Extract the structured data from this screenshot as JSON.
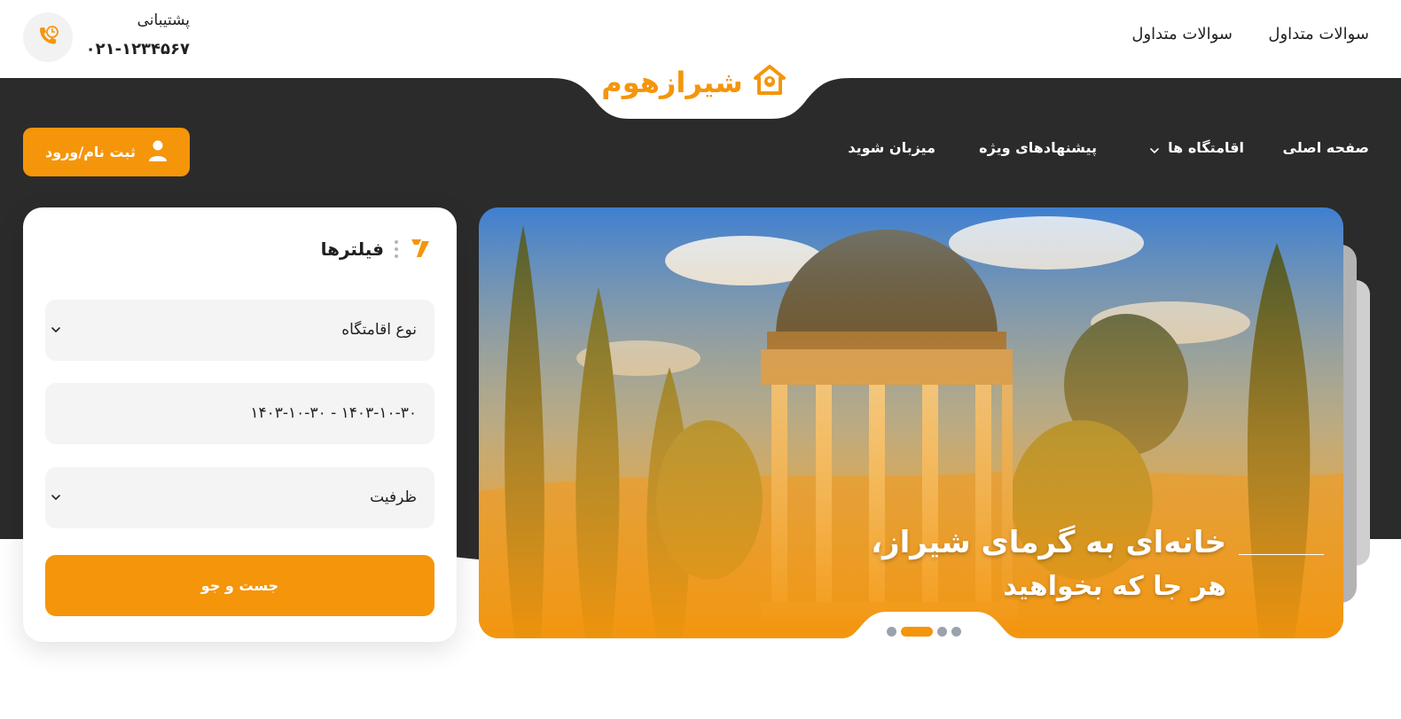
{
  "header": {
    "faq_links": [
      "سوالات متداول",
      "سوالات متداول"
    ],
    "support_label": "پشتیبانی",
    "support_phone": "۰۲۱-۱۲۳۴۵۶۷",
    "support_icon": "phone-clock-icon",
    "logo_text": "شیرازهوم",
    "logo_icon": "house-pin-icon"
  },
  "nav": {
    "items": [
      "صفحه اصلی",
      "اقامتگاه ها",
      "پیشنهادهای ویژه",
      "میزبان شوید"
    ],
    "login_label": "ثبت نام/ورود",
    "login_icon": "user-icon"
  },
  "filters": {
    "title": "فیلترها",
    "title_icon": "filter-icon",
    "accommodation_type": "نوع اقامتگاه",
    "date_range": "۱۴۰۳-۱۰-۳۰ - ۱۴۰۳-۱۰-۳۰",
    "capacity": "ظرفیت",
    "search_label": "جست و جو"
  },
  "hero": {
    "headline": "خانه‌ای به گرمای شیراز،",
    "subline": "هر جا که بخواهید",
    "slide_count": 4,
    "active_slide": 2
  },
  "colors": {
    "accent": "#f5950a",
    "dark": "#2b2b2b",
    "field_bg": "#f4f4f4"
  }
}
